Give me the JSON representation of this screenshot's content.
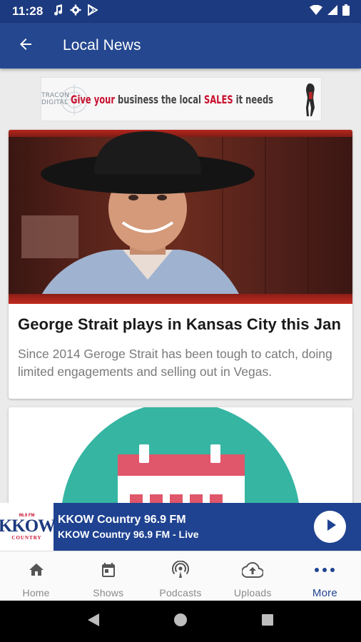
{
  "status_bar": {
    "time": "11:28",
    "left_icons": [
      "music-note-icon",
      "settings-icon",
      "play-store-icon"
    ],
    "right_icons": [
      "wifi-icon",
      "signal-icon",
      "battery-icon"
    ]
  },
  "app_bar": {
    "back_icon": "arrow-left-icon",
    "title": "Local News"
  },
  "ad_banner": {
    "logo_text": "TRACON DIGITAL",
    "text_part1": "Give your",
    "text_part2": " business the local ",
    "text_part3": "SALES",
    "text_part4": " it needs"
  },
  "cards": [
    {
      "title": "George Strait plays in Kansas City this Jan",
      "description": "Since 2014 Geroge Strait has been tough to catch, doing limited engagements and selling out in Vegas."
    },
    {
      "title": "",
      "description": ""
    }
  ],
  "now_playing": {
    "logo_text": "KKOW",
    "logo_sub": "COUNTRY",
    "logo_top": "96.9 FM",
    "station": "KKOW Country 96.9 FM",
    "subtitle": "KKOW Country 96.9 FM - Live",
    "play_icon": "play-icon"
  },
  "bottom_nav": {
    "items": [
      {
        "label": "Home",
        "icon": "home-icon"
      },
      {
        "label": "Shows",
        "icon": "calendar-icon"
      },
      {
        "label": "Podcasts",
        "icon": "podcast-icon"
      },
      {
        "label": "Uploads",
        "icon": "cloud-upload-icon"
      },
      {
        "label": "More",
        "icon": "more-horizontal-icon"
      }
    ],
    "active": "More"
  },
  "colors": {
    "status_bar": "#1c3a7f",
    "app_bar": "#24478f",
    "now_playing": "#1f4391",
    "accent_red": "#c8102e",
    "teal": "#36b5a3",
    "calendar_pink": "#e0566b"
  }
}
